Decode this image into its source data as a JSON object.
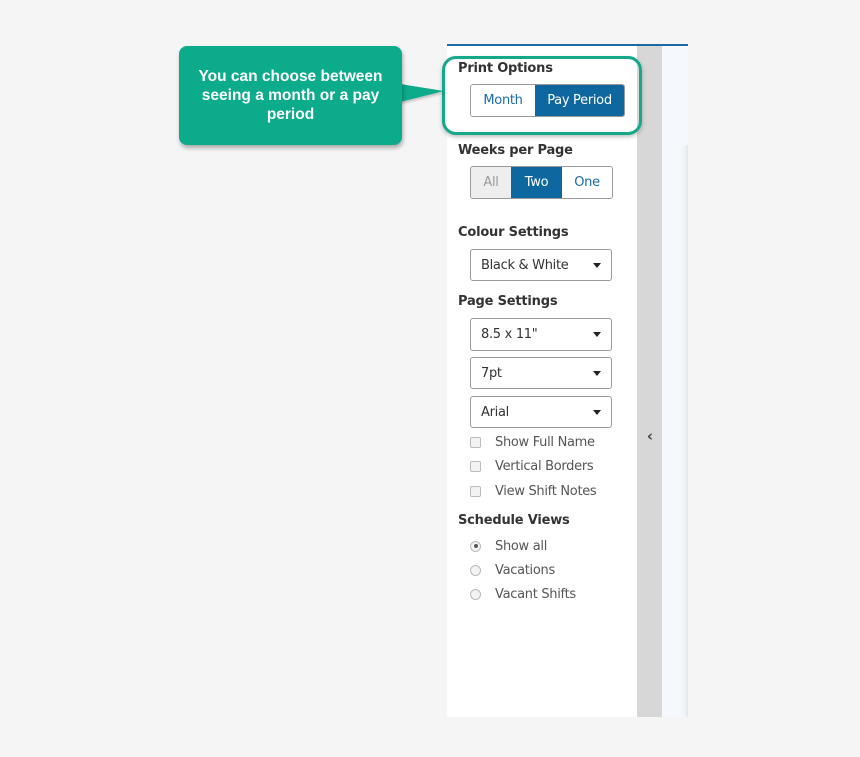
{
  "callout": {
    "text": "You can choose between seeing a month or a pay period",
    "color": "#0bab8b"
  },
  "accent_color": "#0f67a0",
  "print_options": {
    "label": "Print Options",
    "options": [
      {
        "label": "Month",
        "active": false
      },
      {
        "label": "Pay Period",
        "active": true
      }
    ]
  },
  "weeks_per_page": {
    "label": "Weeks per Page",
    "options": [
      {
        "label": "All",
        "state": "disabled"
      },
      {
        "label": "Two",
        "state": "active"
      },
      {
        "label": "One",
        "state": "normal"
      }
    ]
  },
  "colour_settings": {
    "label": "Colour Settings",
    "selected": "Black & White"
  },
  "page_settings": {
    "label": "Page Settings",
    "paper_size": "8.5 x 11\"",
    "font_size": "7pt",
    "font_family": "Arial",
    "checkboxes": [
      {
        "label": "Show Full Name",
        "checked": false
      },
      {
        "label": "Vertical Borders",
        "checked": false
      },
      {
        "label": "View Shift Notes",
        "checked": false
      }
    ]
  },
  "schedule_views": {
    "label": "Schedule Views",
    "options": [
      {
        "label": "Show all",
        "checked": true
      },
      {
        "label": "Vacations",
        "checked": false
      },
      {
        "label": "Vacant Shifts",
        "checked": false
      }
    ]
  },
  "collapse_toggle": {
    "icon": "chevron-left-icon",
    "glyph": "‹"
  }
}
